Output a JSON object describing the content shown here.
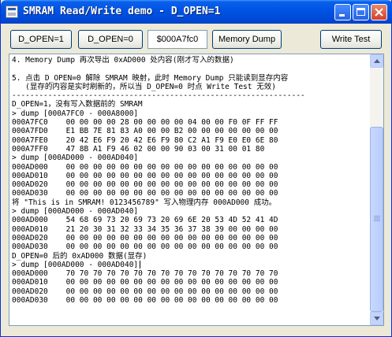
{
  "window": {
    "title": "SMRAM Read/Write demo - D_OPEN=1"
  },
  "toolbar": {
    "btn_open1": "D_OPEN=1",
    "btn_open0": "D_OPEN=0",
    "address_value": "$000A7fc0",
    "btn_dump": "Memory Dump",
    "btn_write": "Write Test"
  },
  "output": {
    "lines": [
      "4. Memory Dump 再次导出 0xAD000 处内容(刚才写入的数据)",
      "",
      "5. 点击 D_OPEN=0 解除 SMRAM 映射，此时 Memory Dump 只能读到显存内容",
      "   (显存的内容是实时刷新的，所以当 D_OPEN=0 时点 Write Test 无效)",
      "-----------------------------------------------------------------",
      "D_OPEN=1，没有写入数据前的 SMRAM",
      "> dump [000A7FC0 - 000A8000]",
      "000A7FC0    00 00 00 00 28 00 00 00 00 04 00 00 F0 0F FF FF",
      "000A7FD0    E1 BB 7E 81 83 A0 00 00 B2 00 00 00 00 00 00 00",
      "000A7FE0    20 42 E6 F9 20 42 E6 F9 80 C2 A1 F9 E0 E0 6E 80",
      "000A7FF0    47 8B A1 F9 46 02 00 00 90 03 00 31 00 01 80",
      "> dump [000AD000 - 000AD040]",
      "000AD000    00 00 00 00 00 00 00 00 00 00 00 00 00 00 00 00",
      "000AD010    00 00 00 00 00 00 00 00 00 00 00 00 00 00 00 00",
      "000AD020    00 00 00 00 00 00 00 00 00 00 00 00 00 00 00 00",
      "000AD030    00 00 00 00 00 00 00 00 00 00 00 00 00 00 00 00",
      "将 \"This is in SMRAM! 0123456789\" 写入物理内存 000AD000 成功。",
      "> dump [000AD000 - 000AD040]",
      "000AD000    54 68 69 73 20 69 73 20 69 6E 20 53 4D 52 41 4D",
      "000AD010    21 20 30 31 32 33 34 35 36 37 38 39 00 00 00 00",
      "000AD020    00 00 00 00 00 00 00 00 00 00 00 00 00 00 00 00",
      "000AD030    00 00 00 00 00 00 00 00 00 00 00 00 00 00 00 00",
      "D_OPEN=0 后的 0xAD000 数据(显存)",
      "> dump [000AD000 - 000AD040]",
      "000AD000    70 70 70 70 70 70 70 70 70 70 70 70 70 70 70 70",
      "000AD010    00 00 00 00 00 00 00 00 00 00 00 00 00 00 00 00",
      "000AD020    00 00 00 00 00 00 00 00 00 00 00 00 00 00 00 00",
      "000AD030    00 00 00 00 00 00 00 00 00 00 00 00 00 00 00 00"
    ]
  }
}
